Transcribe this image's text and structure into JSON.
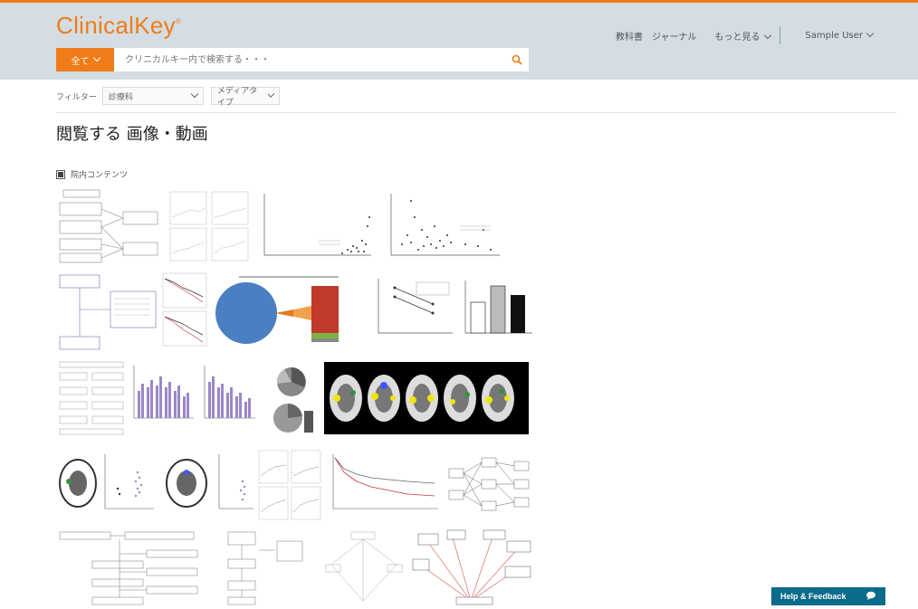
{
  "header": {
    "logo": "ClinicalKey",
    "nav": [
      "教科書",
      "ジャーナル",
      "もっと見る"
    ],
    "user": "Sample User"
  },
  "search": {
    "scope": "全て",
    "placeholder": "クリニカルキー内で検索する・・・"
  },
  "filters": {
    "label": "フィルター",
    "specialty": "診療科",
    "media_type": "メディアタイプ"
  },
  "page": {
    "title": "閲覧する 画像・動画",
    "section": "院内コンテンツ"
  },
  "help": {
    "label": "Help & Feedback"
  },
  "colors": {
    "brand_orange": "#f07c19",
    "header_bg": "#d3dde3",
    "help_bg": "#0a6b8a"
  },
  "icons": [
    "search-icon",
    "chevron-down-icon",
    "chat-bubble-icon",
    "checkbox-icon"
  ]
}
